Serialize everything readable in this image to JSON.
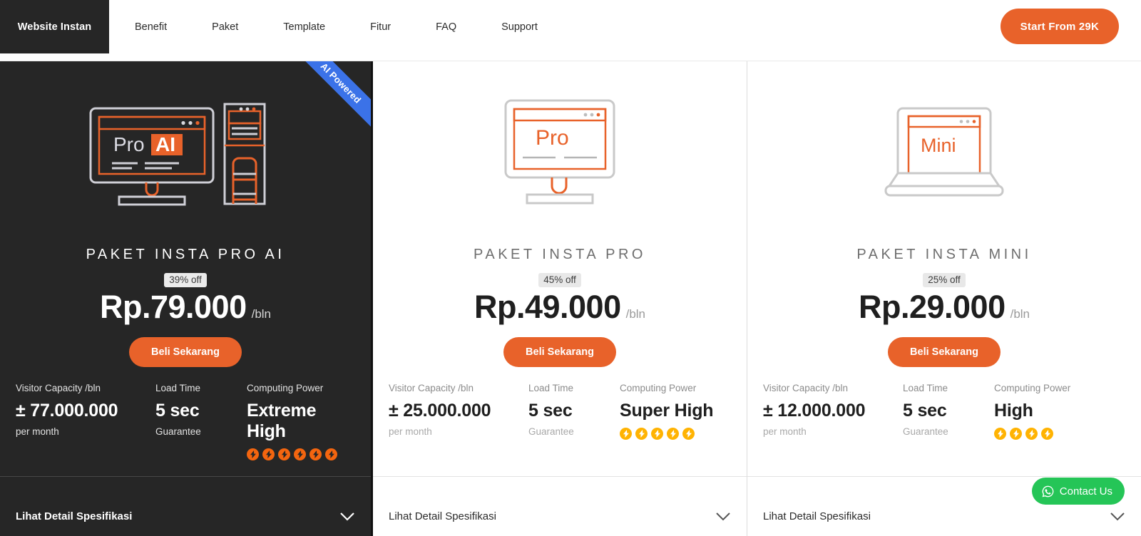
{
  "nav": {
    "brand": "Website Instan",
    "links": [
      "Benefit",
      "Paket",
      "Template",
      "Fitur",
      "FAQ",
      "Support"
    ],
    "cta": "Start From 29K"
  },
  "colors": {
    "accent_orange": "#e8622a",
    "ribbon_blue": "#3b72e8",
    "bolt_orange": "#f4650f",
    "bolt_amber": "#ffb302",
    "whatsapp_green": "#25c557",
    "dark_card": "#262626"
  },
  "spec_labels": {
    "capacity": "Visitor Capacity /bln",
    "load": "Load Time",
    "power": "Computing Power"
  },
  "cards": [
    {
      "ribbon": "AI Powered",
      "illustration": "monitor-tower-proai",
      "screen_label_1": "Pro",
      "screen_label_2": "AI",
      "title": "PAKET INSTA PRO AI",
      "discount": "39% off",
      "price": "Rp.79.000",
      "period": "/bln",
      "buy_label": "Beli Sekarang",
      "capacity_value": "± 77.000.000",
      "capacity_sub": "per month",
      "load_value": "5 sec",
      "load_sub": "Guarantee",
      "power_value": "Extreme High",
      "power_level": 6,
      "detail_label": "Lihat Detail Spesifikasi"
    },
    {
      "ribbon": "",
      "illustration": "monitor-pro",
      "screen_label_1": "Pro",
      "screen_label_2": "",
      "title": "PAKET INSTA PRO",
      "discount": "45% off",
      "price": "Rp.49.000",
      "period": "/bln",
      "buy_label": "Beli Sekarang",
      "capacity_value": "± 25.000.000",
      "capacity_sub": "per month",
      "load_value": "5 sec",
      "load_sub": "Guarantee",
      "power_value": "Super High",
      "power_level": 5,
      "detail_label": "Lihat Detail Spesifikasi"
    },
    {
      "ribbon": "",
      "illustration": "laptop-mini",
      "screen_label_1": "Mini",
      "screen_label_2": "",
      "title": "PAKET INSTA MINI",
      "discount": "25% off",
      "price": "Rp.29.000",
      "period": "/bln",
      "buy_label": "Beli Sekarang",
      "capacity_value": "± 12.000.000",
      "capacity_sub": "per month",
      "load_value": "5 sec",
      "load_sub": "Guarantee",
      "power_value": "High",
      "power_level": 4,
      "detail_label": "Lihat Detail Spesifikasi"
    }
  ],
  "whatsapp": {
    "label": "Contact Us",
    "icon": "whatsapp-icon"
  }
}
